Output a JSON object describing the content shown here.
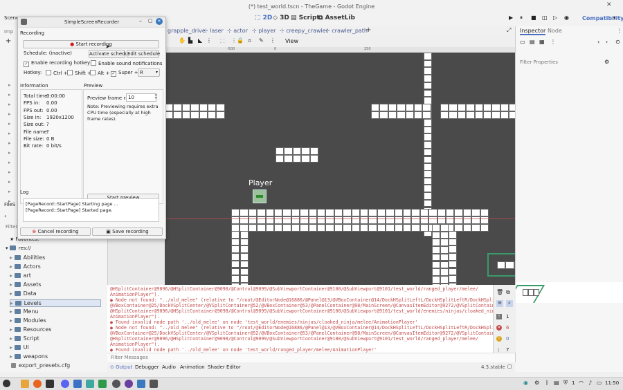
{
  "window_title": "(*) test_world.tscn - TheGame - Godot Engine",
  "main_modes": [
    "2D",
    "3D",
    "Script",
    "AssetLib"
  ],
  "renderer": "Compatibility",
  "scene_tabs": [
    "grapple_drive",
    "laser",
    "actor",
    "player",
    "creepy_crawler",
    "crawler_path"
  ],
  "viewport": {
    "view_label": "View",
    "node_label": "Player",
    "ruler_ticks": [
      "-500",
      "0",
      "250"
    ]
  },
  "left_dock": {
    "scene_tab": "Scene",
    "import_tab": "Imp",
    "filesystem_tab": "FileS",
    "filter_label": "Filter",
    "favorites": "Favorites:",
    "root": "res://",
    "items": [
      "Abilities",
      "Actors",
      "art",
      "Assets",
      "Data",
      "Levels",
      "Menu",
      "Modules",
      "Resources",
      "Script",
      "UI",
      "weapons",
      "export_presets.cfg"
    ]
  },
  "inspector": {
    "tab_inspector": "Inspector",
    "tab_node": "Node",
    "filter_placeholder": "Filter Properties"
  },
  "output": {
    "lines": [
      "@HSplitContainer@9096/@HSplitContainer@9098/@Control@9099/@SubViewportContainer@9100/@SubViewport@9101/test_world/ranged_player/melee/",
      "AnimationPlayer\").",
      "● Node not found: \"../old_melee\" (relative to \"/root/@EditorNode@16886/@Panel@13/@VBoxContainer@14/DockHSplitLeftL/DockHSplitLeftR/DockHSplitMain/",
      "@VBoxContainer@25/DockVSplitCenter/@VSplitContainer@52/@VBoxContainer@53/@PanelContainer@98/MainScreen/@CanvasItemEditor@9272/@VSplitContainer@9094/",
      "@HSplitContainer@9096/@HSplitContainer@9098/@Control@9099/@SubViewportContainer@9100/@SubViewport@9101/test_world/enemies/ninjas/cloaked_ninja/melee/",
      "AnimationPlayer\").",
      "● Found invalid node path '../old_melee' on node 'test_world/enemies/ninjas/cloaked_ninja/melee/AnimationPlayer'",
      "● Node not found: \"../old_melee\" (relative to \"/root/@EditorNode@16886/@Panel@13/@VBoxContainer@14/DockHSplitLeftL/DockHSplitLeftR/DockHSplitMain/",
      "@VBoxContainer@25/DockVSplitCenter/@VSplitContainer@52/@VBoxContainer@53/@PanelContainer@98/MainScreen/@CanvasItemEditor@9272/@VSplitContainer@9094/",
      "@HSplitContainer@9096/@HSplitContainer@9098/@Control@9099/@SubViewportContainer@9100/@SubViewport@9101/test_world/ranged_player/melee/",
      "AnimationPlayer\").",
      "● Found invalid node path '../old_melee' on node 'test_world/ranged_player/melee/AnimationPlayer'"
    ],
    "filter_placeholder": "Filter Messages",
    "counts": {
      "errors": "1",
      "warnings": "6",
      "info": "0",
      "other": "7"
    }
  },
  "bottom_tabs": [
    "Output",
    "Debugger",
    "Audio",
    "Animation",
    "Shader Editor"
  ],
  "version": "4.3.stable",
  "dialog": {
    "title": "SimpleScreenRecorder",
    "recording_section": "Recording",
    "start_recording": "Start recording",
    "schedule_label": "Schedule: (inactive)",
    "activate_schedule": "Activate schedule",
    "edit_schedule": "Edit schedule",
    "enable_hotkey": "Enable recording hotkey",
    "enable_sound": "Enable sound notifications",
    "hotkey_label": "Hotkey:",
    "ctrl": "Ctrl +",
    "shift": "Shift +",
    "alt": "Alt +",
    "super": "Super +",
    "key": "R",
    "information_section": "Information",
    "info_rows": [
      {
        "k": "Total time:",
        "v": "0:00:00"
      },
      {
        "k": "FPS in:",
        "v": "0.00"
      },
      {
        "k": "FPS out:",
        "v": "0.00"
      },
      {
        "k": "Size in:",
        "v": "1920x1200"
      },
      {
        "k": "Size out:",
        "v": "?"
      },
      {
        "k": "File name:",
        "v": "?"
      },
      {
        "k": "File size:",
        "v": "0 B"
      },
      {
        "k": "Bit rate:",
        "v": "0 bit/s"
      }
    ],
    "preview_section": "Preview",
    "preview_rate_label": "Preview frame rate:",
    "preview_rate_value": "10",
    "preview_note": "Note: Previewing requires extra CPU time (especially at high frame rates).",
    "start_preview": "Start preview",
    "log_section": "Log",
    "log_lines": [
      "[PageRecord::StartPage] Starting page ...",
      "[PageRecord::StartPage] Started page."
    ],
    "cancel_recording": "Cancel recording",
    "save_recording": "Save recording"
  },
  "taskbar": {
    "clock": "11:50",
    "tray_count": "1"
  },
  "colors": {
    "viewport_bg": "#4a4a4a",
    "accent": "#4a6fc0",
    "error": "#c24a4a"
  }
}
